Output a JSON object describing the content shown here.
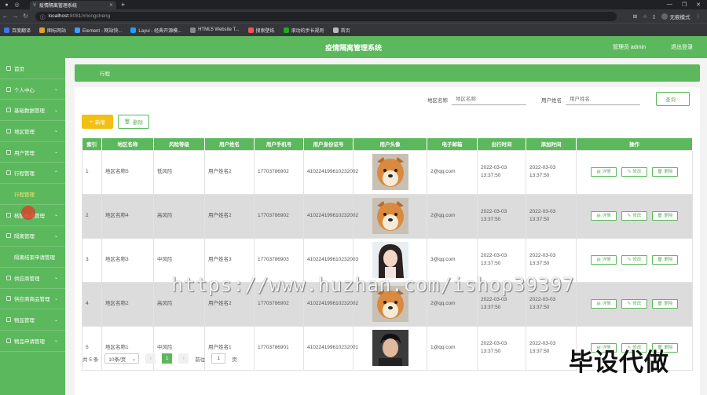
{
  "browser": {
    "tab_title": "疫情隔离管理系统",
    "url_host": "localhost",
    "url_path": ":8081/#/xingcheng",
    "profile": "无痕模式",
    "bookmarks": [
      "百度翻译",
      "图标网站",
      "Element - 网站快...",
      "Layui - 经典开源模...",
      "HTML5 Website T...",
      "搜索壁纸",
      "滚动的步长规则",
      "首页"
    ]
  },
  "header": {
    "title": "疫情隔离管理系统",
    "user": "管理员 admin",
    "logout": "退出登录"
  },
  "sidebar": {
    "items": [
      {
        "label": "首页",
        "chevron": false
      },
      {
        "label": "个人中心",
        "chevron": true
      },
      {
        "label": "基础数据管理",
        "chevron": true
      },
      {
        "label": "地区管理",
        "chevron": true
      },
      {
        "label": "用户管理",
        "chevron": true
      },
      {
        "label": "行程管理",
        "chevron": true,
        "open": true
      },
      {
        "label": "行程管理",
        "sub": true,
        "active": true
      },
      {
        "label": "核酸检测管理",
        "chevron": true
      },
      {
        "label": "隔离管理",
        "chevron": true
      },
      {
        "label": "隔离结束申请管理",
        "chevron": false
      },
      {
        "label": "供应商管理",
        "chevron": true
      },
      {
        "label": "供应商商品管理",
        "chevron": true
      },
      {
        "label": "物品管理",
        "chevron": true
      },
      {
        "label": "物品申请管理",
        "chevron": true
      }
    ]
  },
  "breadcrumb": "行程",
  "search": {
    "area_label": "地区名称",
    "area_placeholder": "地区名称",
    "user_label": "用户姓名",
    "user_placeholder": "用户姓名",
    "query_button": "查询"
  },
  "actions": {
    "add": "新增",
    "delete": "删除"
  },
  "table": {
    "columns": [
      "索引",
      "地区名称",
      "风险等级",
      "用户姓名",
      "用户手机号",
      "用户身份证号",
      "用户头像",
      "电子邮箱",
      "出行时间",
      "添加时间",
      "操作"
    ],
    "rows": [
      {
        "idx": "1",
        "area": "地区名称5",
        "risk": "低风险",
        "name": "用户姓名2",
        "phone": "17703786902",
        "id": "410224199610232002",
        "avatar": "dog",
        "email": "2@qq.com",
        "travel": "2022-03-03 13:37:50",
        "added": "2022-03-03 13:37:50"
      },
      {
        "idx": "2",
        "area": "地区名称4",
        "risk": "高风险",
        "name": "用户姓名2",
        "phone": "17703786902",
        "id": "410224199610232002",
        "avatar": "dog",
        "email": "2@qq.com",
        "travel": "2022-03-03 13:37:50",
        "added": "2022-03-03 13:37:50"
      },
      {
        "idx": "3",
        "area": "地区名称3",
        "risk": "中风险",
        "name": "用户姓名3",
        "phone": "17703786903",
        "id": "410224199610232003",
        "avatar": "woman",
        "email": "3@qq.com",
        "travel": "2022-03-03 13:37:50",
        "added": "2022-03-03 13:37:50"
      },
      {
        "idx": "4",
        "area": "地区名称2",
        "risk": "高风险",
        "name": "用户姓名2",
        "phone": "17703786902",
        "id": "410224199610232002",
        "avatar": "dog",
        "email": "2@qq.com",
        "travel": "2022-03-03 13:37:50",
        "added": "2022-03-03 13:37:50"
      },
      {
        "idx": "5",
        "area": "地区名称1",
        "risk": "中风险",
        "name": "用户姓名1",
        "phone": "17703786901",
        "id": "410224199610232001",
        "avatar": "man",
        "email": "1@qq.com",
        "travel": "2022-03-03 13:37:50",
        "added": "2022-03-03 13:37:50"
      }
    ],
    "ops": {
      "detail": "详情",
      "edit": "修改",
      "delete": "删除"
    }
  },
  "pagination": {
    "total": "共 5 条",
    "page_size": "10条/页",
    "current": "1",
    "goto_label": "前往",
    "goto_value": "1",
    "page_suffix": "页"
  },
  "overlay": {
    "watermark": "https://www.huzhan.com/ishop39397",
    "stamp": "毕设代做"
  },
  "colors": {
    "brand_green": "#5cb85c",
    "add_yellow": "#f2c014"
  }
}
